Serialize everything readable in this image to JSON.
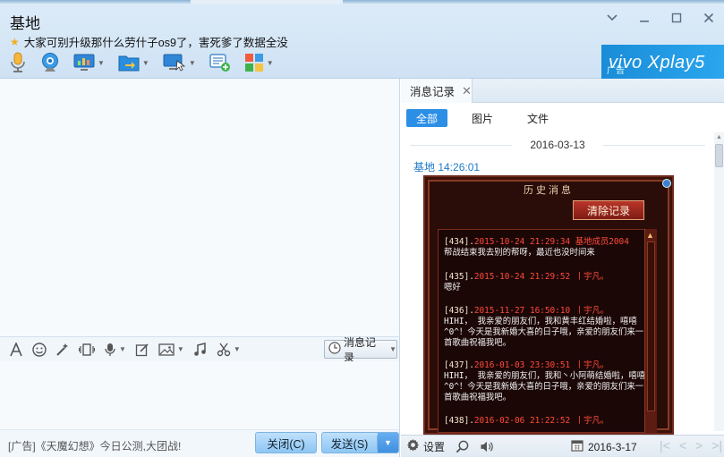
{
  "window": {
    "title": "基地",
    "status_message": "大家可别升级那什么劳什子os9了，害死爹了数据全没"
  },
  "ad_banner": {
    "brand": "vivo Xplay5",
    "tag": "广告"
  },
  "input_toolbar": {
    "history_button": "消息记录"
  },
  "bottom_bar": {
    "ad_text": "[广告]《天魔幻想》今日公测,大团战!",
    "close_label": "关闭(C)",
    "send_label": "发送(S)"
  },
  "history": {
    "tab_label": "消息记录",
    "filters": [
      "全部",
      "图片",
      "文件"
    ],
    "date_separator": "2016-03-13",
    "sender": "基地  14:26:01",
    "settings_label": "设置",
    "current_date": "2016-3-17"
  },
  "game_image": {
    "title": "历史消息",
    "clear_button": "清除记录",
    "entries": [
      {
        "idx": "[434].",
        "meta": "2015-10-24 21:29:34 基地成员2004",
        "text": "帮战结束我去别的帮呀，最近也没时间来"
      },
      {
        "idx": "[435].",
        "meta": "2015-10-24 21:29:52 丨宇凡。",
        "text": "嗯好"
      },
      {
        "idx": "[436].",
        "meta": "2015-11-27 16:50:10 丨宇凡。",
        "text": "HIHI， 我亲爱的朋友们，我和黄丰红结婚啦，嘻嘻^0^！今天是我新婚大喜的日子哦，亲爱的朋友们来一首歌曲祝福我吧。"
      },
      {
        "idx": "[437].",
        "meta": "2016-01-03 23:30:51 丨宇凡。",
        "text": "HIHI， 我亲爱的朋友们，我和丶小阿萌结婚啦，嘻嘻^0^！今天是我新婚大喜的日子哦，亲爱的朋友们来一首歌曲祝福我吧。"
      },
      {
        "idx": "[438].",
        "meta": "2016-02-06 21:22:52 丨宇凡。",
        "text": ""
      }
    ]
  },
  "colors": {
    "accent_blue": "#2c8fe6",
    "sender_blue": "#1f7ac7",
    "game_red": "#ff4b3a"
  }
}
